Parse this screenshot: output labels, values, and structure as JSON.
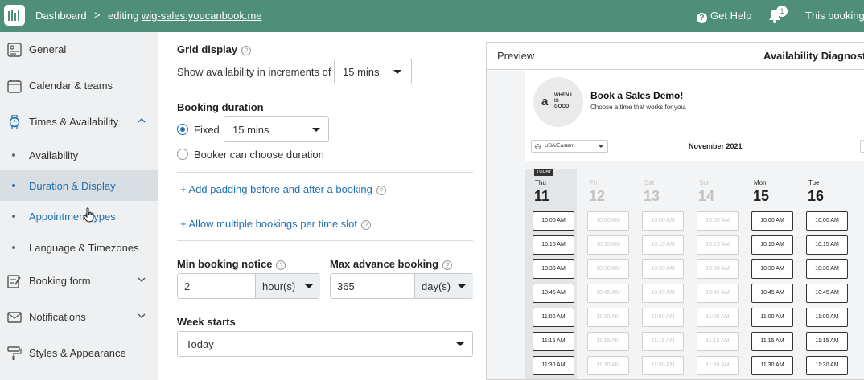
{
  "topbar": {
    "dashboard": "Dashboard",
    "separator": ">",
    "editing_prefix": "editing",
    "editing_site": "wig-sales.youcanbook.me",
    "help": "Get Help",
    "notification_count": "1",
    "right_text": "This booking"
  },
  "sidebar": {
    "general": "General",
    "calendar": "Calendar & teams",
    "times": "Times & Availability",
    "sub": {
      "availability": "Availability",
      "duration": "Duration & Display",
      "appointment": "Appointment types",
      "language": "Language & Timezones"
    },
    "booking_form": "Booking form",
    "notifications": "Notifications",
    "styles": "Styles & Appearance"
  },
  "settings": {
    "grid_title": "Grid display",
    "increments_label": "Show availability in increments of",
    "increments_value": "15 mins",
    "duration_title": "Booking duration",
    "fixed_label": "Fixed",
    "fixed_value": "15 mins",
    "choose_label": "Booker can choose duration",
    "padding_link": "+ Add padding before and after a booking",
    "multiple_link": "+ Allow multiple bookings per time slot",
    "min_notice_title": "Min booking notice",
    "min_notice_value": "2",
    "min_notice_unit": "hour(s)",
    "max_advance_title": "Max advance booking",
    "max_advance_value": "365",
    "max_advance_unit": "day(s)",
    "week_starts_title": "Week starts",
    "week_starts_value": "Today"
  },
  "preview": {
    "tab_preview": "Preview",
    "tab_diag": "Availability Diagnostics",
    "logo_initial": "a",
    "logo_words": "WHEN I IS GOOD",
    "title": "Book a Sales Demo!",
    "subtitle": "Choose a time that works for you.",
    "timezone": "USA/Eastern",
    "month": "November 2021",
    "today_badge": "TODAY",
    "days": [
      {
        "name": "Thu",
        "num": "11",
        "state": "today"
      },
      {
        "name": "Fri",
        "num": "12",
        "state": "dim"
      },
      {
        "name": "Sat",
        "num": "13",
        "state": "dim"
      },
      {
        "name": "Sun",
        "num": "14",
        "state": "dim"
      },
      {
        "name": "Mon",
        "num": "15",
        "state": "live"
      },
      {
        "name": "Tue",
        "num": "16",
        "state": "live"
      }
    ],
    "slots": [
      "10:00 AM",
      "10:15 AM",
      "10:30 AM",
      "10:45 AM",
      "11:00 AM",
      "11:15 AM",
      "11:30 AM"
    ]
  }
}
